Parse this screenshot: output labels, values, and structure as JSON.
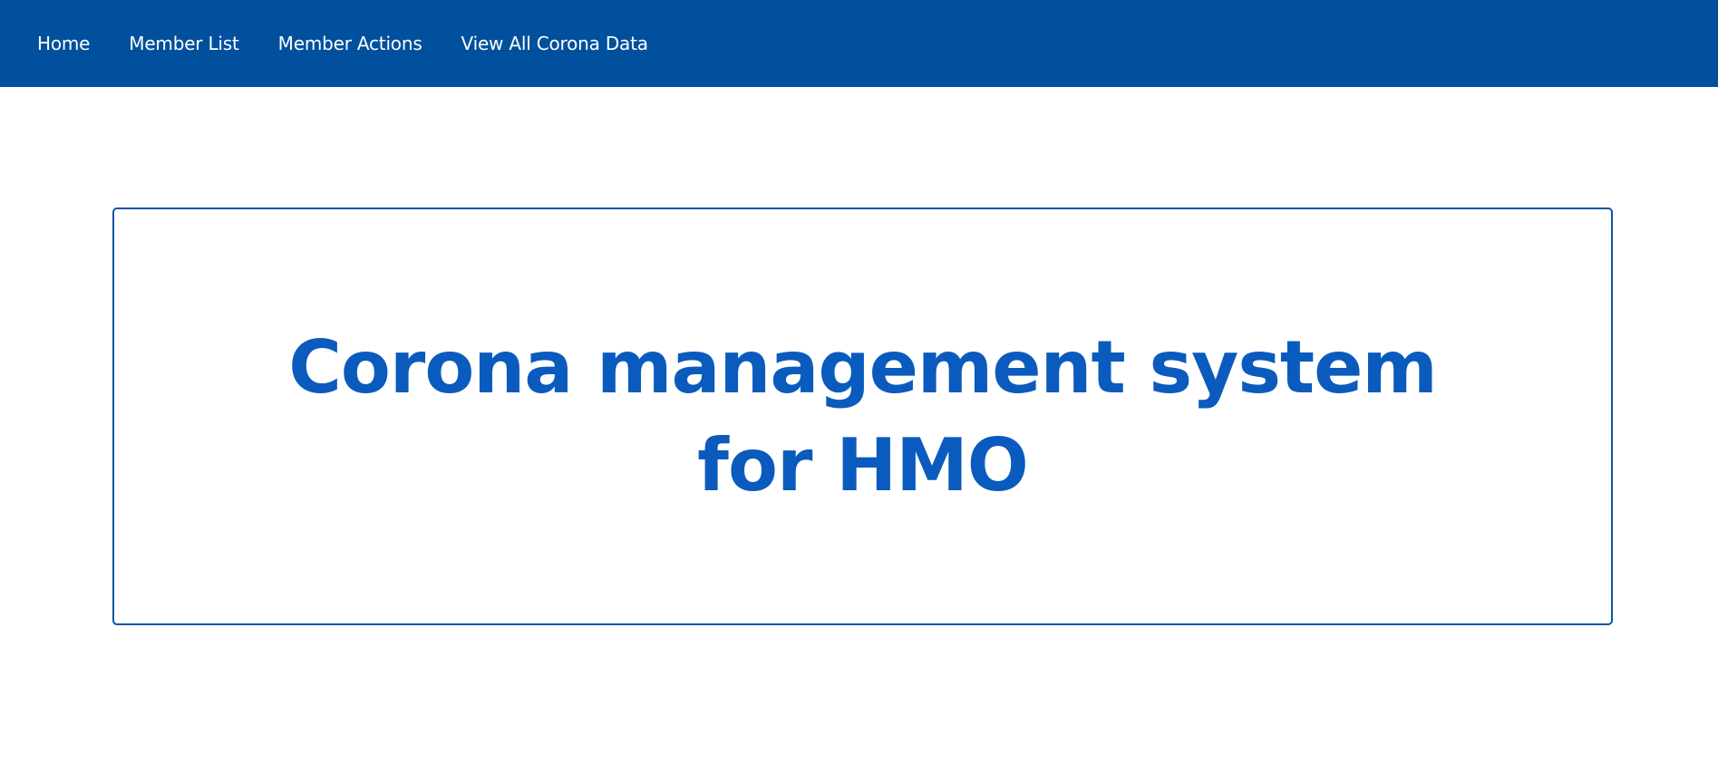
{
  "nav": {
    "items": [
      {
        "label": "Home"
      },
      {
        "label": "Member List"
      },
      {
        "label": "Member Actions"
      },
      {
        "label": "View All Corona Data"
      }
    ]
  },
  "hero": {
    "title": "Corona management system for HMO"
  },
  "colors": {
    "navbar_bg": "#00509d",
    "nav_text": "#ffffff",
    "title_text": "#0a5bbd",
    "card_border": "#0b55a6",
    "page_bg": "#ffffff"
  }
}
